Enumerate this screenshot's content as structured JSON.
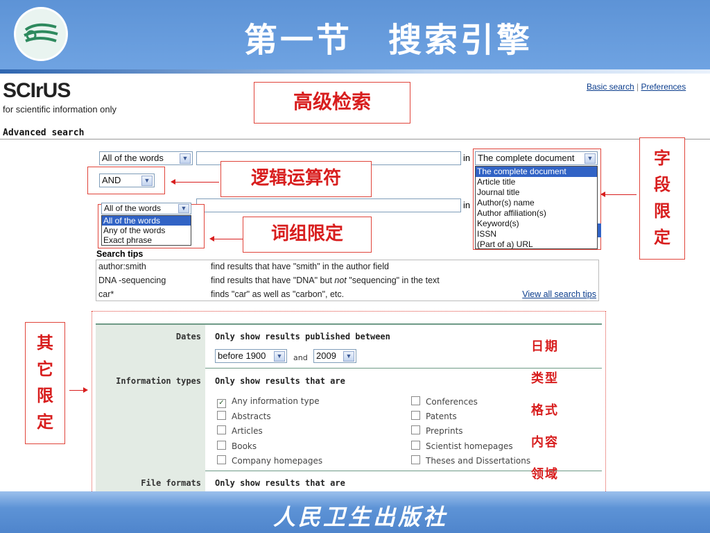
{
  "slide": {
    "title": "第一节　搜索引擎",
    "footer_publisher": "人民卫生出版社",
    "colors": {
      "header_blue": "#6fa3e2",
      "annotation_red": "#d81e1e"
    }
  },
  "site": {
    "logo": "SCIrUS",
    "tagline": "for scientific information only",
    "links": {
      "basic_search": "Basic search",
      "separator": "|",
      "preferences": "Preferences"
    },
    "page_label": "Advanced search"
  },
  "annotations": {
    "advanced_search": "高级检索",
    "logic_operators": "逻辑运算符",
    "phrase_limit": "词组限定",
    "field_limit": [
      "字",
      "段",
      "限",
      "定"
    ],
    "other_limit": [
      "其",
      "它",
      "限",
      "定"
    ],
    "side_items": [
      "日期",
      "类型",
      "格式",
      "内容",
      "领域"
    ]
  },
  "search_form": {
    "row1_mode": "All of the words",
    "in_label": "in",
    "field_selected": "The complete document",
    "field_options": [
      "The complete document",
      "Article title",
      "Journal title",
      "Author(s) name",
      "Author affiliation(s)",
      "Keyword(s)",
      "ISSN",
      "(Part of a) URL"
    ],
    "operator": "AND",
    "row2_mode": "All of the words",
    "mode_options": [
      "All of the words",
      "Any of the words",
      "Exact phrase"
    ]
  },
  "search_tips": {
    "title": "Search tips",
    "rows": [
      {
        "example": "author:smith",
        "desc_pre": "find results that have \"smith\" in the author field",
        "desc_em": "",
        "desc_post": ""
      },
      {
        "example": "DNA -sequencing",
        "desc_pre": "find results that have \"DNA\" but ",
        "desc_em": "not",
        "desc_post": " \"sequencing\" in the text"
      },
      {
        "example": "car*",
        "desc_pre": "finds \"car\" as well as \"carbon\", etc.",
        "desc_em": "",
        "desc_post": ""
      }
    ],
    "view_all": "View all search tips"
  },
  "filters": {
    "dates": {
      "label": "Dates",
      "heading": "Only show results published between",
      "from": "before 1900",
      "and": "and",
      "to": "2009"
    },
    "info_types": {
      "label": "Information types",
      "heading": "Only show results that are",
      "left": [
        {
          "name": "Any information type",
          "checked": true
        },
        {
          "name": "Abstracts",
          "checked": false
        },
        {
          "name": "Articles",
          "checked": false
        },
        {
          "name": "Books",
          "checked": false
        },
        {
          "name": "Company homepages",
          "checked": false
        }
      ],
      "right": [
        {
          "name": "Conferences",
          "checked": false
        },
        {
          "name": "Patents",
          "checked": false
        },
        {
          "name": "Preprints",
          "checked": false
        },
        {
          "name": "Scientist homepages",
          "checked": false
        },
        {
          "name": "Theses and Dissertations",
          "checked": false
        }
      ]
    },
    "file_formats": {
      "label": "File formats",
      "heading": "Only show results that are"
    }
  }
}
